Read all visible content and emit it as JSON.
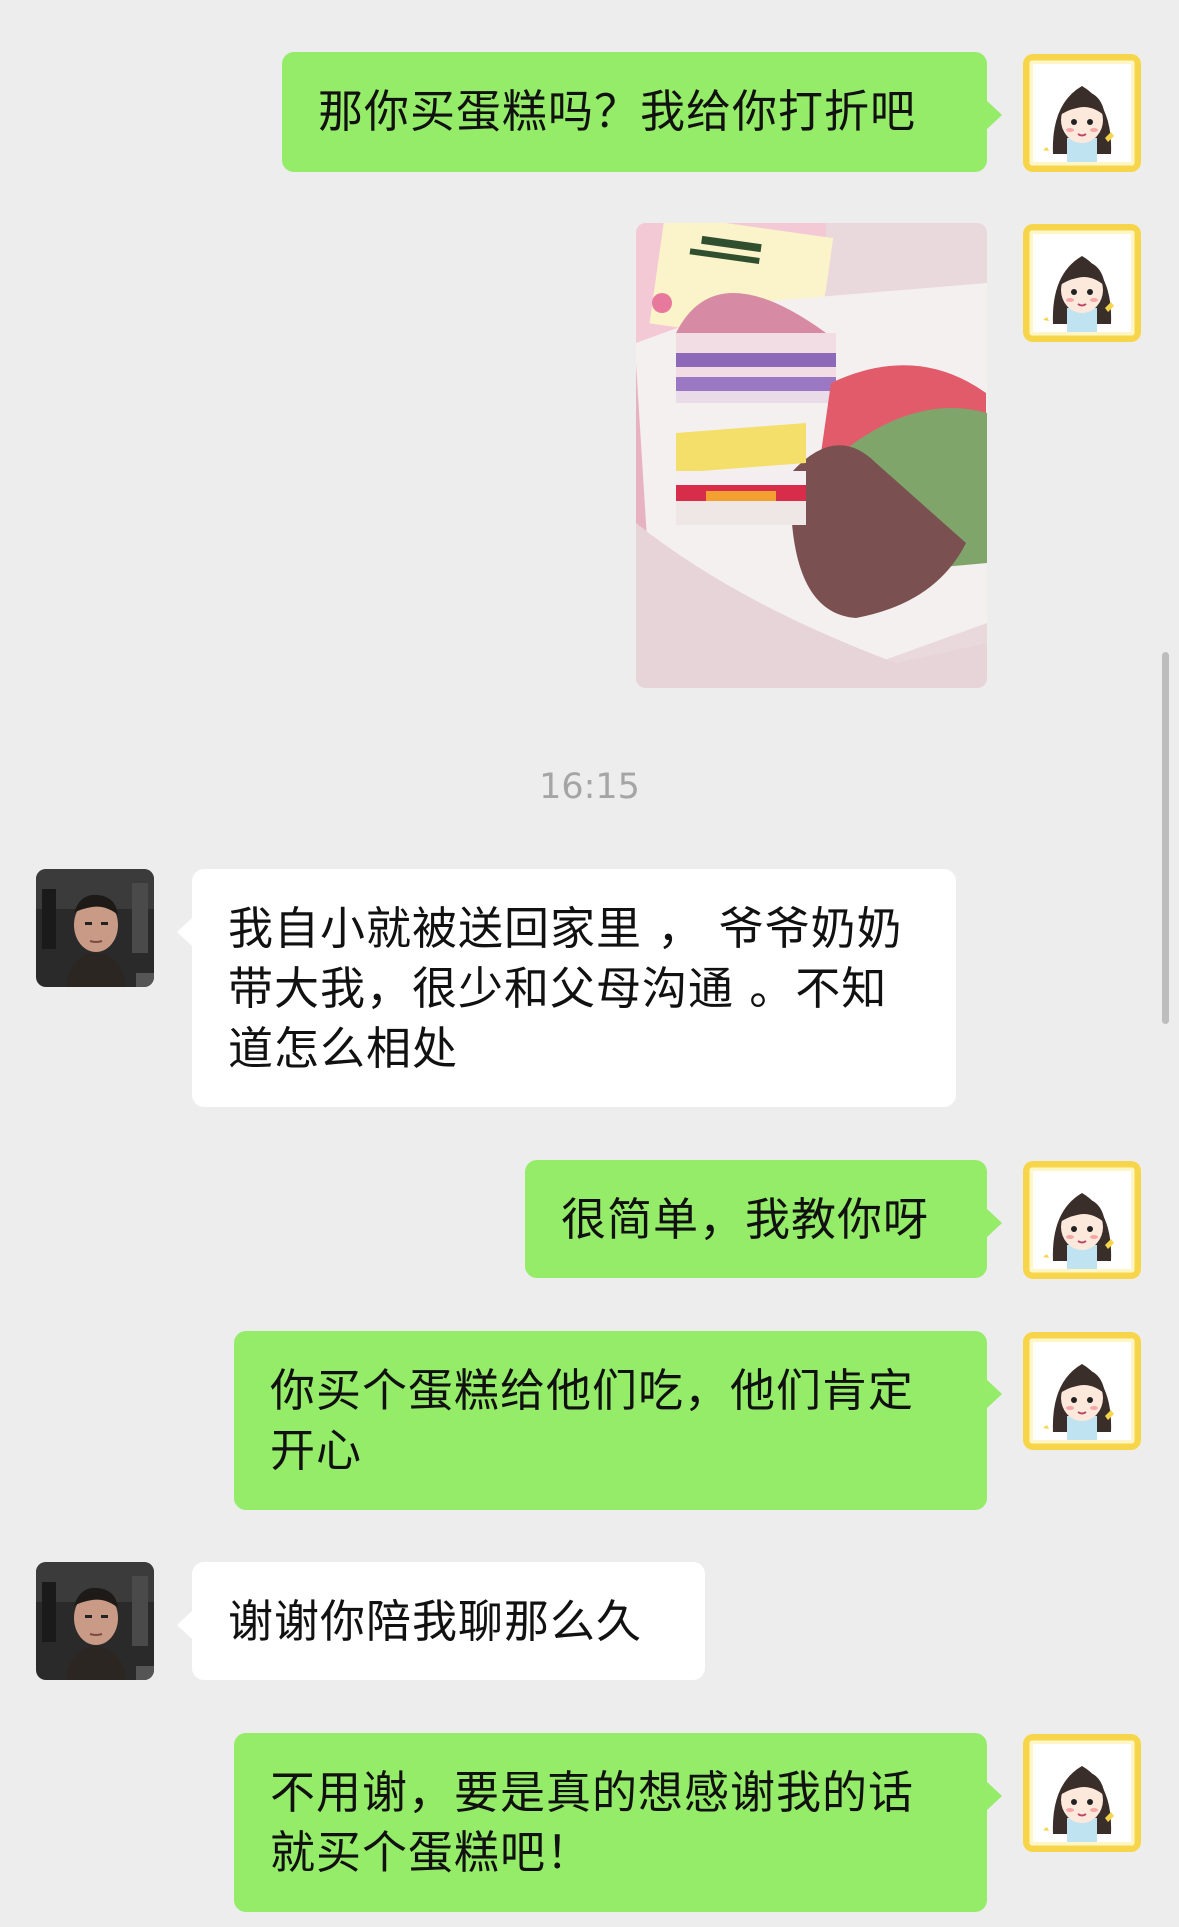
{
  "timestamp": "16:15",
  "messages": [
    {
      "sender": "me",
      "text": "那你买蛋糕吗？我给你打折吧"
    },
    {
      "sender": "me",
      "type": "image",
      "image_icon": "crepe-cake-photo"
    },
    {
      "sender": "other",
      "text": "我自小就被送回家里 ， 爷爷奶奶带大我，很少和父母沟通 。不知道怎么相处"
    },
    {
      "sender": "me",
      "text": "很简单，我教你呀"
    },
    {
      "sender": "me",
      "text": "你买个蛋糕给他们吃，他们肯定开心"
    },
    {
      "sender": "other",
      "text": "谢谢你陪我聊那么久"
    },
    {
      "sender": "me",
      "text": "不用谢，要是真的想感谢我的话就买个蛋糕吧！"
    }
  ],
  "avatars": {
    "me_icon": "cartoon-girl-avatar",
    "other_icon": "man-selfie-avatar"
  },
  "colors": {
    "background": "#ededed",
    "my_bubble": "#95ec69",
    "other_bubble": "#ffffff",
    "avatar_frame": "#f7d54a"
  }
}
